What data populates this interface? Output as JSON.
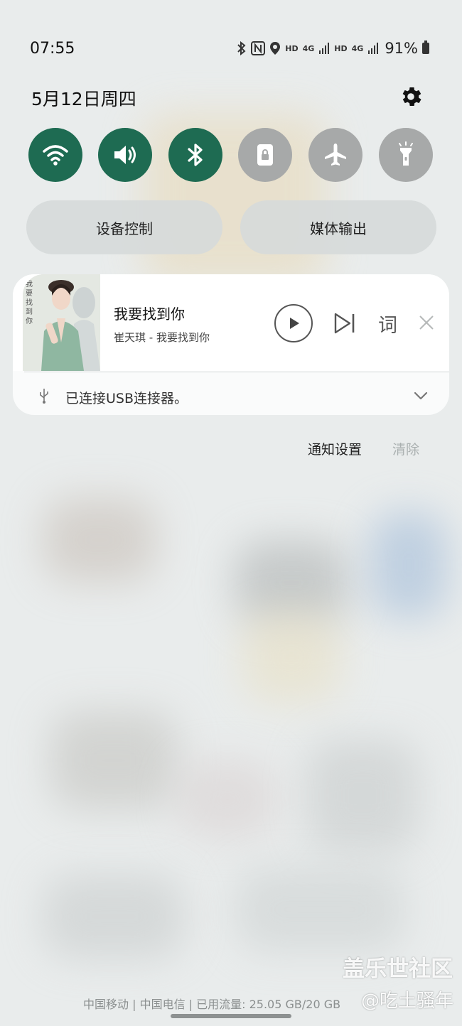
{
  "status_bar": {
    "time": "07:55",
    "net_labels": [
      "HD",
      "4G",
      "HD",
      "4G"
    ],
    "battery": "91%"
  },
  "header": {
    "date": "5月12日周四"
  },
  "quick_toggles": [
    {
      "name": "wifi",
      "active": true
    },
    {
      "name": "sound",
      "active": true
    },
    {
      "name": "bluetooth",
      "active": true
    },
    {
      "name": "rotation-lock",
      "active": false
    },
    {
      "name": "airplane-mode",
      "active": false
    },
    {
      "name": "flashlight",
      "active": false
    }
  ],
  "buttons": {
    "device_control": "设备控制",
    "media_output": "媒体输出"
  },
  "media": {
    "title": "我要找到你",
    "artist": "崔天琪 - 我要找到你",
    "lyrics_label": "词",
    "album_art_text": "我要找到你"
  },
  "usb_notification": {
    "text": "已连接USB连接器。"
  },
  "notification_actions": {
    "settings": "通知设置",
    "clear": "清除"
  },
  "footer": {
    "carrier_info": "中国移动 | 中国电信 | 已用流量: 25.05 GB/20 GB",
    "watermark": "盖乐世社区",
    "watermark_user": "@吃土骚年"
  },
  "colors": {
    "toggle_on": "#1e6b52",
    "toggle_off": "#a7a9a9"
  }
}
